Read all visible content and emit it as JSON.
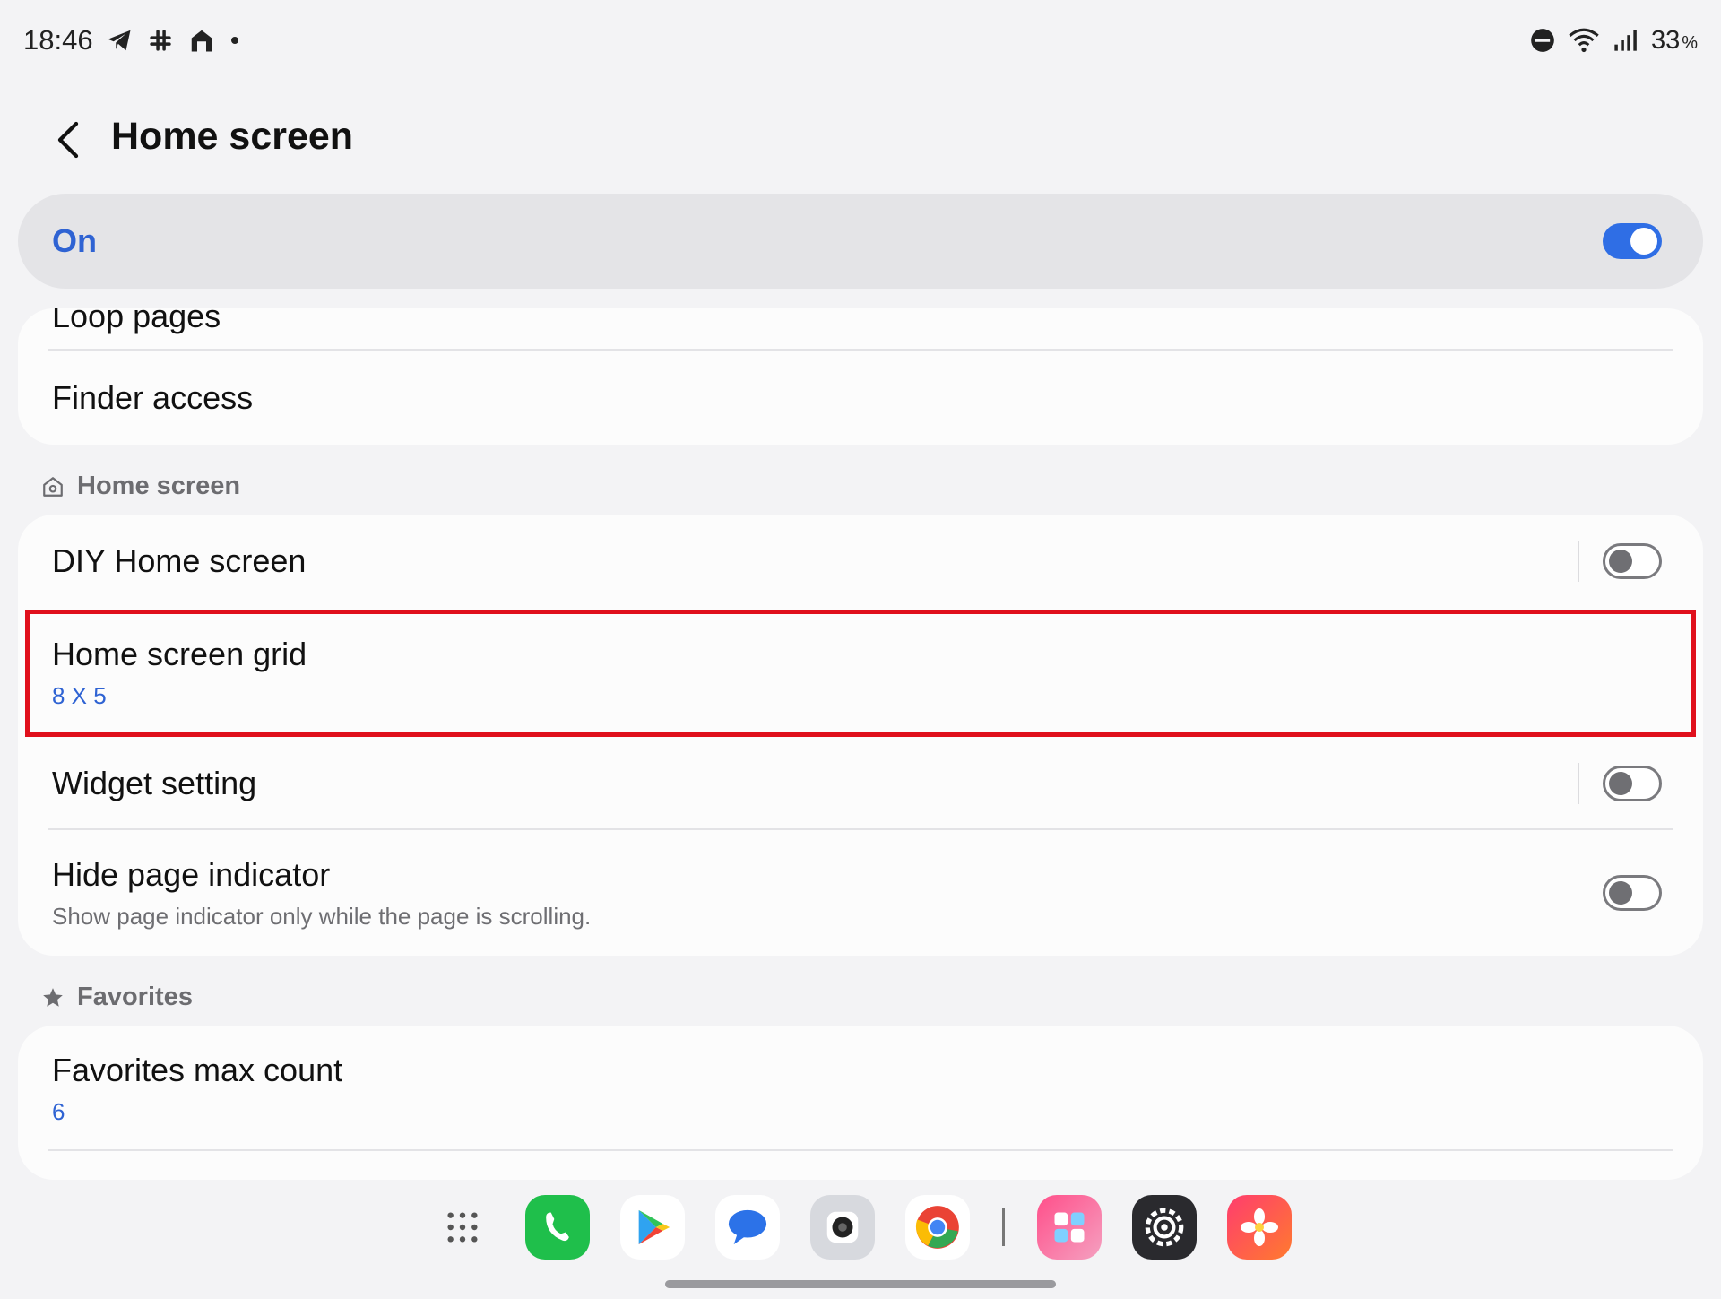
{
  "status_bar": {
    "time": "18:46",
    "battery_value": "33",
    "battery_unit": "%"
  },
  "header": {
    "title": "Home screen"
  },
  "master_switch": {
    "label": "On",
    "state": "on",
    "accent_color": "#2f6ee5"
  },
  "top_card": {
    "partial_label": "Loop pages",
    "finder_access": "Finder access"
  },
  "home_screen_section": {
    "header": "Home screen",
    "items": {
      "diy_home_screen": {
        "title": "DIY Home screen",
        "toggle": "off"
      },
      "home_screen_grid": {
        "title": "Home screen grid",
        "value": "8 X 5"
      },
      "widget_setting": {
        "title": "Widget setting",
        "toggle": "off"
      },
      "hide_page_indicator": {
        "title": "Hide page indicator",
        "subtitle": "Show page indicator only while the page is scrolling.",
        "toggle": "off"
      }
    }
  },
  "favorites_section": {
    "header": "Favorites",
    "items": {
      "favorites_max_count": {
        "title": "Favorites max count",
        "value": "6"
      }
    }
  },
  "dock": {
    "apps": [
      "app-drawer",
      "phone",
      "play-store",
      "messages",
      "camera",
      "chrome",
      "good-lock",
      "settings",
      "gallery"
    ]
  },
  "highlight_color": "#e0101c"
}
